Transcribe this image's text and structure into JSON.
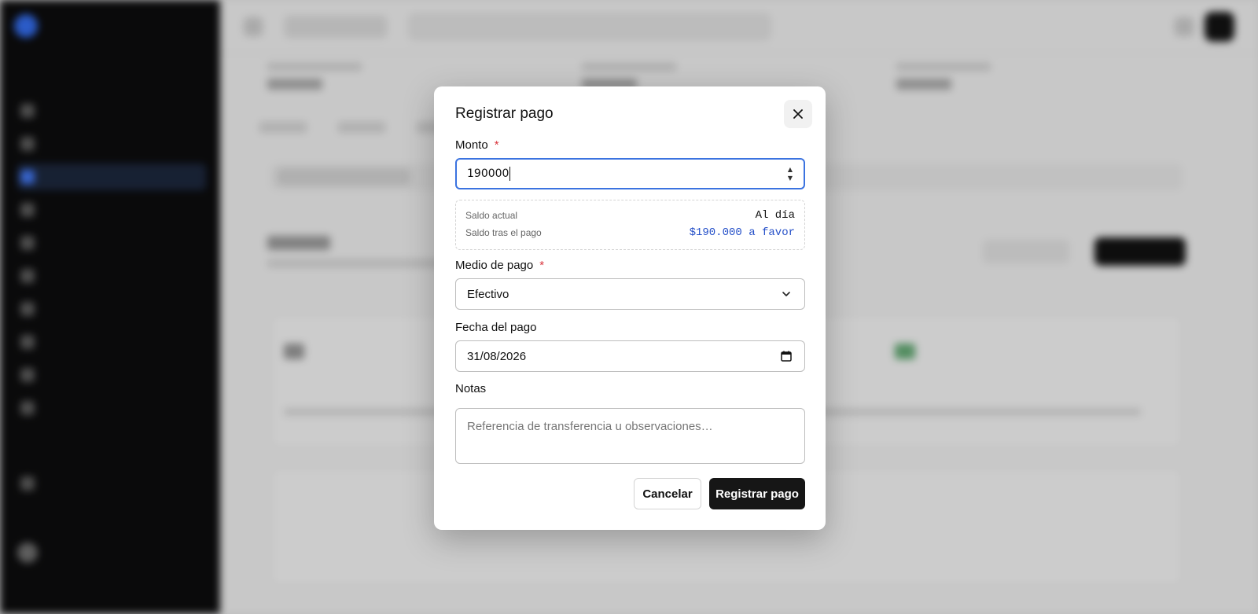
{
  "modal": {
    "title": "Registrar pago",
    "close_icon": "close-icon",
    "amount": {
      "label": "Monto",
      "required_mark": "*",
      "value": "190000"
    },
    "balance": {
      "current_label": "Saldo actual",
      "current_value": "Al día",
      "after_label": "Saldo tras el pago",
      "after_value": "$190.000 a favor",
      "after_color": "#2550c8"
    },
    "payment_method": {
      "label": "Medio de pago",
      "required_mark": "*",
      "value": "Efectivo",
      "icon": "chevron-down-icon"
    },
    "payment_date": {
      "label": "Fecha del pago",
      "value": "31/08/2026",
      "icon": "calendar-icon"
    },
    "notes": {
      "label": "Notas",
      "placeholder": "Referencia de transferencia u observaciones…"
    },
    "cancel_label": "Cancelar",
    "submit_label": "Registrar pago"
  },
  "colors": {
    "focus_border": "#3b73e0",
    "required": "#d9363e",
    "primary_button": "#161616",
    "sidebar_bg": "#0b0b0c",
    "sidebar_accent": "#3d6ee0"
  }
}
